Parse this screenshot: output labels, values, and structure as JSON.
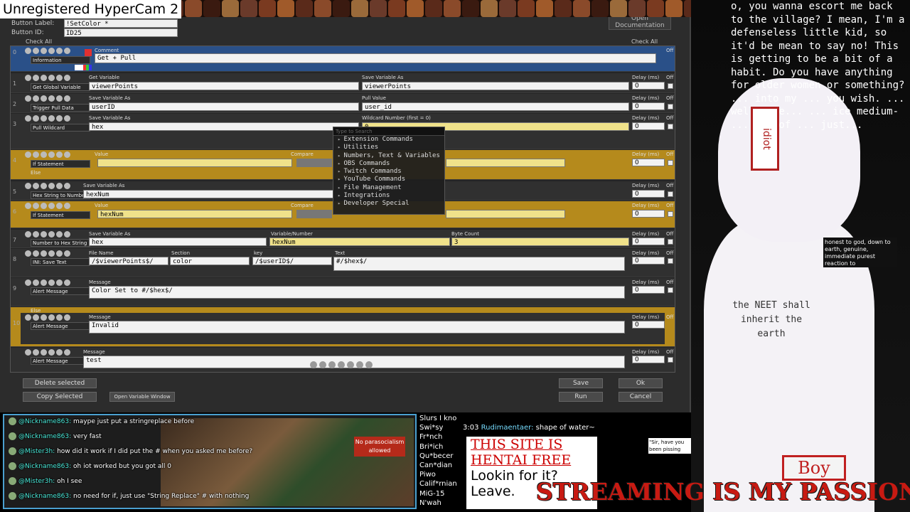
{
  "recorder_title": "Unregistered HyperCam 2",
  "editor": {
    "button_label_caption": "Button Label:",
    "button_label_value": "!SetColor *",
    "button_id_caption": "Button ID:",
    "button_id_value": "ID25",
    "check_all_left": "Check All",
    "check_all_right": "Check All",
    "open_documentation": "Open Documentation",
    "delete_selected": "Delete selected",
    "copy_selected": "Copy Selected",
    "open_variable_window": "Open Variable Window",
    "save": "Save",
    "run": "Run",
    "ok": "Ok",
    "cancel": "Cancel"
  },
  "rows": {
    "r0": {
      "num": "0",
      "type": "Information",
      "label_a": "Comment",
      "value_a": "Get + Pull",
      "off": "Off"
    },
    "r1": {
      "num": "1",
      "type": "Get Global Variable",
      "label_a": "Get Variable",
      "value_a": "viewerPoints",
      "label_b": "Save Variable As",
      "value_b": "viewerPoints",
      "delay_label": "Delay (ms)",
      "delay": "0",
      "off": "Off"
    },
    "r2": {
      "num": "2",
      "type": "Trigger Pull Data",
      "label_a": "Save Variable As",
      "value_a": "userID",
      "label_b": "Pull Value",
      "value_b": "user_id",
      "delay_label": "Delay (ms)",
      "delay": "0",
      "off": "Off"
    },
    "r3": {
      "num": "3",
      "type": "Pull Wildcard",
      "label_a": "Save Variable As",
      "value_a": "hex",
      "label_b": "Wildcard Number (first = 0)",
      "value_b": "0",
      "delay_label": "Delay (ms)",
      "delay": "0",
      "off": "Off"
    },
    "r4": {
      "num": "4",
      "type": "If Statement",
      "label_a": "Value",
      "label_b": "Compare",
      "delay_label": "Delay (ms)",
      "delay": "0",
      "off": "Off",
      "else": "Else"
    },
    "r5": {
      "num": "5",
      "type": "Hex String to Number",
      "label_a": "Save Variable As",
      "value_a": "hexNum",
      "delay_label": "Delay (ms)",
      "delay": "0",
      "off": "Off"
    },
    "r6": {
      "num": "6",
      "type": "If Statement",
      "label_a": "Value",
      "value_a": "hexNum",
      "label_b": "Compare",
      "delay_label": "Delay (ms)",
      "delay": "0",
      "off": "Off"
    },
    "r7": {
      "num": "7",
      "type": "Number to Hex String",
      "label_a": "Save Variable As",
      "value_a": "hex",
      "label_b": "Variable/Number",
      "value_b": "hexNum",
      "label_c": "Byte Count",
      "value_c": "3",
      "delay_label": "Delay (ms)",
      "delay": "0",
      "off": "Off"
    },
    "r8": {
      "num": "8",
      "type": "INI: Save Text",
      "label_a": "File Name",
      "value_a": "/$viewerPoints$/",
      "label_b": "Section",
      "value_b": "color",
      "label_c": "key",
      "value_c": "/$userID$/",
      "label_d": "Text",
      "value_d": "#/$hex$/",
      "delay_label": "Delay (ms)",
      "delay": "0",
      "off": "Off"
    },
    "r9": {
      "num": "9",
      "type": "Alert Message",
      "label_a": "Message",
      "value_a": "Color Set to #/$hex$/",
      "delay_label": "Delay (ms)",
      "delay": "0",
      "off": "Off"
    },
    "r10": {
      "num": "10",
      "type": "Alert Message",
      "label_a": "Message",
      "value_a": "Invalid",
      "delay_label": "Delay (ms)",
      "delay": "0",
      "off": "Off",
      "else": "Else"
    },
    "r11": {
      "num": "11",
      "type": "Alert Message",
      "label_a": "Message",
      "value_a": "test",
      "delay_label": "Delay (ms)",
      "delay": "0",
      "off": "Off"
    }
  },
  "context_menu": {
    "search_placeholder": "Type to Search",
    "items": [
      "Extension Commands",
      "Utilities",
      "Numbers, Text & Variables",
      "OBS Commands",
      "Twitch Commands",
      "YouTube Commands",
      "File Management",
      "Integrations",
      "Developer Special"
    ]
  },
  "chat": {
    "lines": [
      {
        "name": "@Nickname863:",
        "text": "maype just put a stringreplace before"
      },
      {
        "name": "@Nickname863:",
        "text": "very fast"
      },
      {
        "name": "@Mister3h:",
        "text": "how did it work if I did put the # when you asked me before?"
      },
      {
        "name": "@Nickname863:",
        "text": "oh iot worked but you got all 0"
      },
      {
        "name": "@Mister3h:",
        "text": "oh I see"
      },
      {
        "name": "@Nickname863:",
        "text": "no need for if, just use \"String Replace\" # with nothing"
      }
    ],
    "parasocial_sign": "No parasocialism allowed"
  },
  "word_list": [
    "Slurs I kno",
    "Swi*sy",
    "Fr*nch",
    "Bri*ich",
    "Qu*becer",
    "Can*dian",
    "Piwo",
    "Calif*rnian",
    "MiG-15",
    "N'wah"
  ],
  "side_chat": {
    "time": "3:03",
    "name": "Rudimaentaer:",
    "text": "shape of water~"
  },
  "ad": {
    "line1": "THIS SITE IS",
    "line2": "HENTAI FREE",
    "line3": "Lookin for it?",
    "line4": "Leave."
  },
  "vtuber": {
    "speech": "o, you wanna escort me back to the village? I mean, I'm a defenseless little kid, so it'd be mean to say no! This is getting to be a bit of a habit. Do you have anything for older women or something? ... into my ... you wish. ... well-done... ... ice medium- ... any of ... just...",
    "shirt_text_1": "the NEET shall",
    "shirt_text_2": "inherit the",
    "shirt_text_3": "earth",
    "head_tag": "idiot",
    "boy_sign": "Boy",
    "banner": "STREAMING IS MY PASSION",
    "mini_caption": "honest to god, down to earth, genuine, immediate purest reaction to",
    "mini_caption_2": "\"Sir, have you been pissing tonight?\""
  }
}
